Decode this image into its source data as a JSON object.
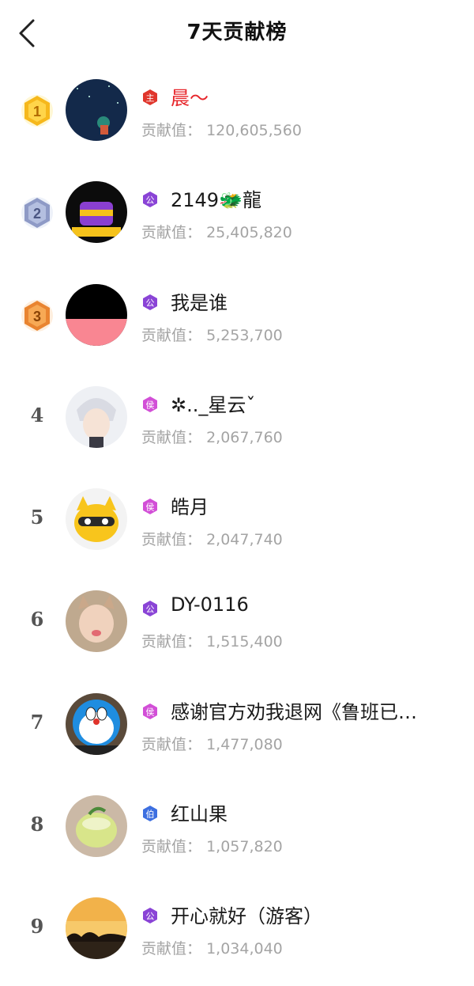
{
  "header": {
    "title": "7天贡献榜",
    "back_icon": "chevron-left-icon"
  },
  "contribution_label": "贡献值：",
  "ranking": [
    {
      "rank": "1",
      "badge": "gold",
      "level": "主",
      "level_color": "#e0362c",
      "name": "晨～",
      "name_color": "#e7262b",
      "value": "120,605,560",
      "avatar": "night-sky-avatar"
    },
    {
      "rank": "2",
      "badge": "silver",
      "level": "公",
      "level_color": "#8a44d6",
      "name": "2149🐲龍",
      "name_color": "#1a1a1a",
      "value": "25,405,820",
      "avatar": "treasure-chest-avatar"
    },
    {
      "rank": "3",
      "badge": "bronze",
      "level": "公",
      "level_color": "#8a44d6",
      "name": "我是谁",
      "name_color": "#1a1a1a",
      "value": "5,253,700",
      "avatar": "black-pink-avatar"
    },
    {
      "rank": "4",
      "badge": "none",
      "level": "侯",
      "level_color": "#d24fd7",
      "name": "✲.._星云ˇ",
      "name_color": "#1a1a1a",
      "value": "2,067,760",
      "avatar": "anime-boy-avatar"
    },
    {
      "rank": "5",
      "badge": "none",
      "level": "侯",
      "level_color": "#d24fd7",
      "name": "皓月",
      "name_color": "#1a1a1a",
      "value": "2,047,740",
      "avatar": "raccoon-avatar"
    },
    {
      "rank": "6",
      "badge": "none",
      "level": "公",
      "level_color": "#8a44d6",
      "name": "DY-0116",
      "name_color": "#1a1a1a",
      "value": "1,515,400",
      "avatar": "baby-cat-avatar"
    },
    {
      "rank": "7",
      "badge": "none",
      "level": "侯",
      "level_color": "#d24fd7",
      "name": "感谢官方劝我退网《鲁班已…",
      "name_color": "#1a1a1a",
      "value": "1,477,080",
      "avatar": "doraemon-avatar"
    },
    {
      "rank": "8",
      "badge": "none",
      "level": "伯",
      "level_color": "#3d6fe0",
      "name": "红山果",
      "name_color": "#1a1a1a",
      "value": "1,057,820",
      "avatar": "drink-avatar"
    },
    {
      "rank": "9",
      "badge": "none",
      "level": "公",
      "level_color": "#8a44d6",
      "name": "开心就好（游客）",
      "name_color": "#1a1a1a",
      "value": "1,034,040",
      "avatar": "sunset-avatar"
    }
  ]
}
